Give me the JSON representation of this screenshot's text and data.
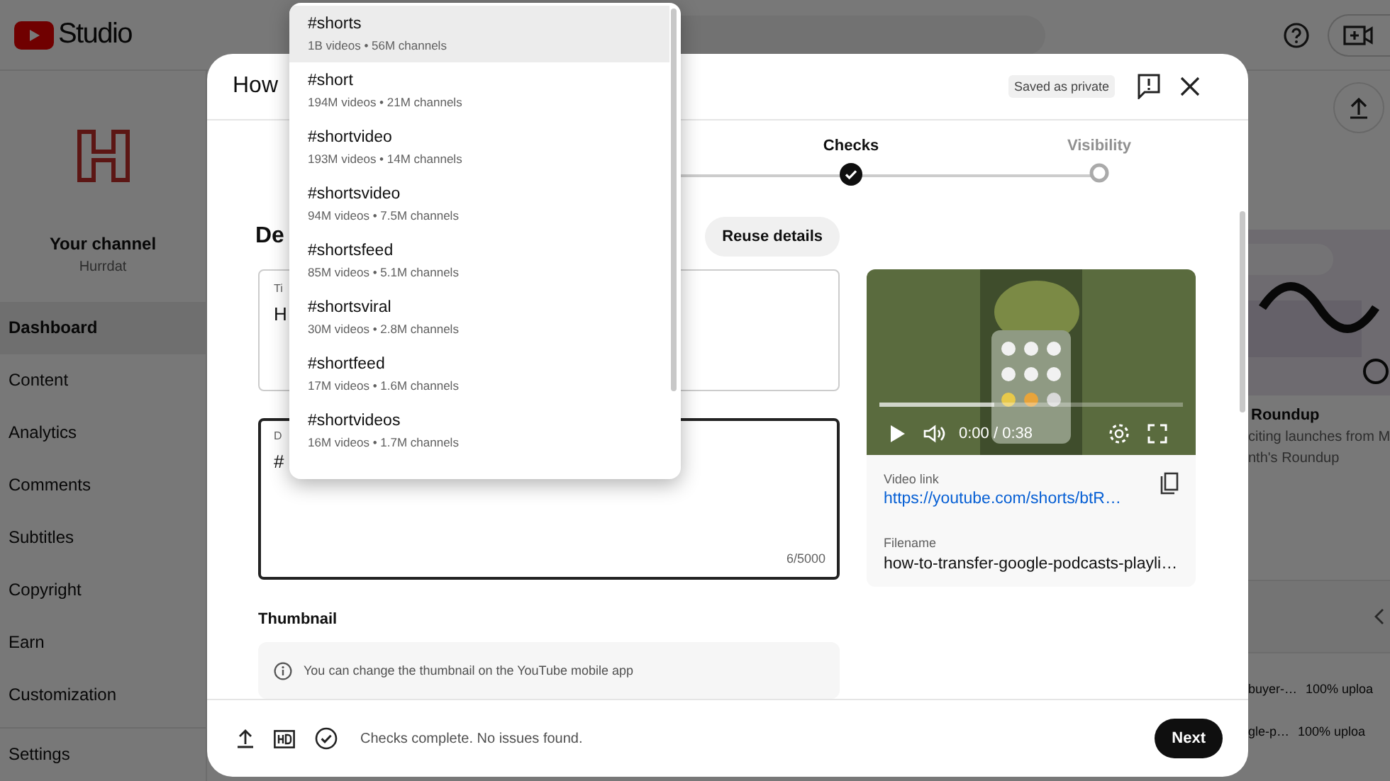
{
  "app": {
    "name": "Studio"
  },
  "sidebar": {
    "channel_label": "Your channel",
    "channel_name": "Hurrdat",
    "items": [
      {
        "label": "Dashboard",
        "selected": true
      },
      {
        "label": "Content",
        "selected": false
      },
      {
        "label": "Analytics",
        "selected": false
      },
      {
        "label": "Comments",
        "selected": false
      },
      {
        "label": "Subtitles",
        "selected": false
      },
      {
        "label": "Copyright",
        "selected": false
      },
      {
        "label": "Earn",
        "selected": false
      },
      {
        "label": "Customization",
        "selected": false
      }
    ],
    "settings": "Settings"
  },
  "background": {
    "card_title": "Roundup",
    "card_lines": [
      "citing launches from M",
      "nth's Roundup"
    ],
    "uploads": [
      {
        "file": "buyer-…",
        "status": "100% uploa"
      },
      {
        "file": "gle-p…",
        "status": "100% uploa"
      }
    ]
  },
  "dialog": {
    "title": "How",
    "saved_badge": "Saved as private",
    "steps": [
      {
        "label": "Checks",
        "done": true
      },
      {
        "label": "Visibility",
        "done": false
      }
    ],
    "heading": "De",
    "reuse_button": "Reuse details",
    "title_field": {
      "label": "Ti",
      "value": "H"
    },
    "description_field": {
      "label": "D",
      "value": "#",
      "counter": "6/5000"
    },
    "thumbnail": {
      "heading": "Thumbnail",
      "note": "You can change the thumbnail on the YouTube mobile app"
    },
    "video": {
      "time": "0:00 / 0:38",
      "buffer": {
        "level": 0.38
      },
      "link_label": "Video link",
      "link": "https://youtube.com/shorts/btR…",
      "filename_label": "Filename",
      "filename": "how-to-transfer-google-podcasts-playli…"
    },
    "footer": {
      "status": "Checks complete. No issues found.",
      "next": "Next"
    }
  },
  "hashtag_suggestions": [
    {
      "tag": "#shorts",
      "stats": "1B videos • 56M channels",
      "selected": true
    },
    {
      "tag": "#short",
      "stats": "194M videos • 21M channels",
      "selected": false
    },
    {
      "tag": "#shortvideo",
      "stats": "193M videos • 14M channels",
      "selected": false
    },
    {
      "tag": "#shortsvideo",
      "stats": "94M videos • 7.5M channels",
      "selected": false
    },
    {
      "tag": "#shortsfeed",
      "stats": "85M videos • 5.1M channels",
      "selected": false
    },
    {
      "tag": "#shortsviral",
      "stats": "30M videos • 2.8M channels",
      "selected": false
    },
    {
      "tag": "#shortfeed",
      "stats": "17M videos • 1.6M channels",
      "selected": false
    },
    {
      "tag": "#shortvideos",
      "stats": "16M videos • 1.7M channels",
      "selected": false
    }
  ]
}
